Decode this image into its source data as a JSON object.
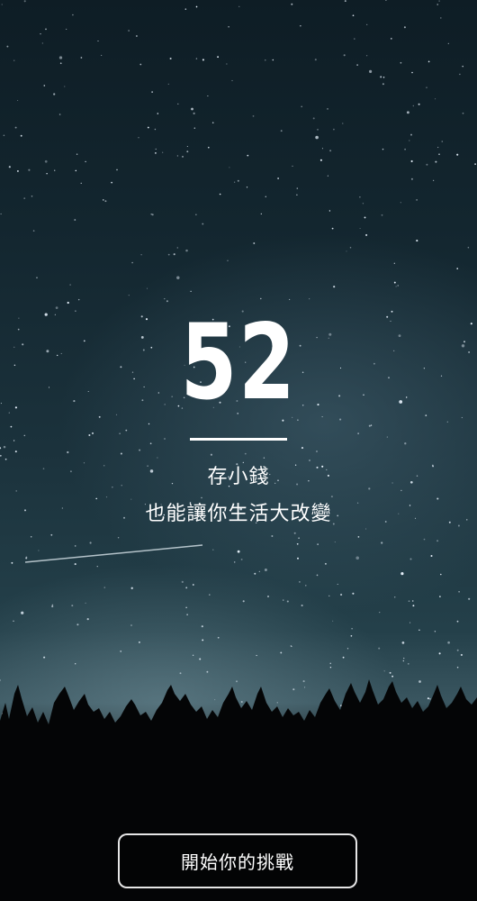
{
  "hero": {
    "number": "52",
    "tagline_line1": "存小錢",
    "tagline_line2": "也能讓你生活大改變"
  },
  "actions": {
    "start_label": "開始你的挑戰"
  },
  "colors": {
    "sky_top": "#0e1d25",
    "sky_glow": "#3a5660",
    "text": "#ffffff"
  }
}
